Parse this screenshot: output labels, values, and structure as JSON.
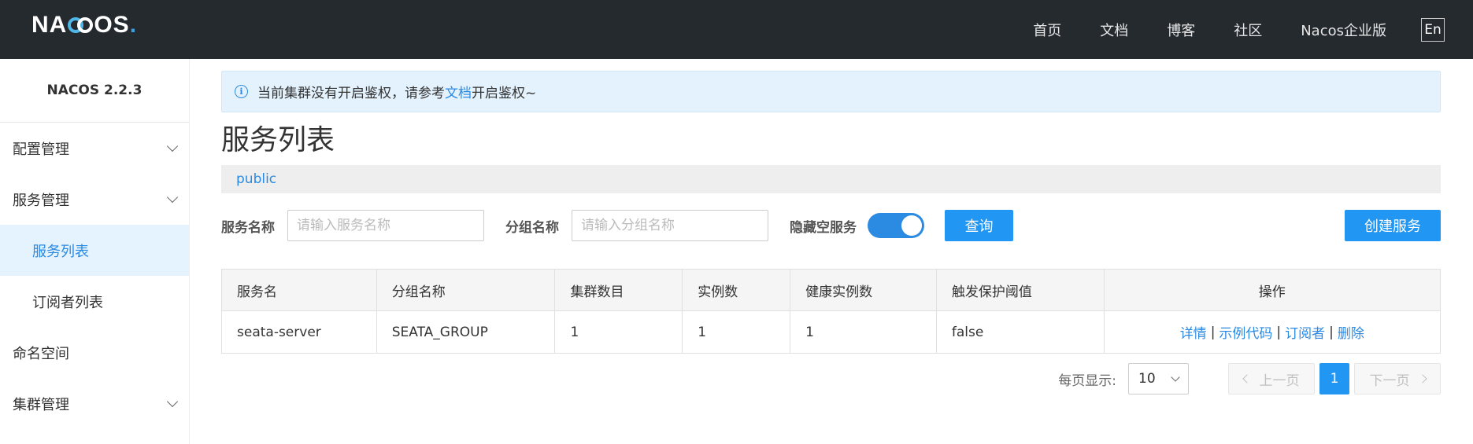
{
  "header": {
    "logo": "NACOS.",
    "nav": [
      "首页",
      "文档",
      "博客",
      "社区",
      "Nacos企业版"
    ],
    "lang_button": "En"
  },
  "sidebar": {
    "title": "NACOS 2.2.3",
    "items": [
      {
        "label": "配置管理",
        "expandable": true
      },
      {
        "label": "服务管理",
        "expandable": true
      },
      {
        "label": "服务列表",
        "sub": true,
        "active": true
      },
      {
        "label": "订阅者列表",
        "sub": true
      },
      {
        "label": "命名空间"
      },
      {
        "label": "集群管理",
        "expandable": true
      }
    ]
  },
  "notice": {
    "text_before": "当前集群没有开启鉴权，请参考",
    "link": "文档",
    "text_after": "开启鉴权~"
  },
  "page_title": "服务列表",
  "namespace": "public",
  "filters": {
    "service_name_label": "服务名称",
    "service_name_placeholder": "请输入服务名称",
    "group_name_label": "分组名称",
    "group_name_placeholder": "请输入分组名称",
    "hide_empty_label": "隐藏空服务",
    "hide_empty_on": true,
    "query_button": "查询",
    "create_button": "创建服务"
  },
  "table": {
    "columns": [
      "服务名",
      "分组名称",
      "集群数目",
      "实例数",
      "健康实例数",
      "触发保护阈值",
      "操作"
    ],
    "rows": [
      {
        "service": "seata-server",
        "group": "SEATA_GROUP",
        "clusters": "1",
        "instances": "1",
        "healthy": "1",
        "threshold": "false"
      }
    ],
    "ops": [
      "详情",
      "示例代码",
      "订阅者",
      "删除"
    ],
    "ops_separator": "|"
  },
  "pagination": {
    "per_page_label": "每页显示:",
    "per_page": "10",
    "prev": "上一页",
    "current": "1",
    "next": "下一页"
  }
}
